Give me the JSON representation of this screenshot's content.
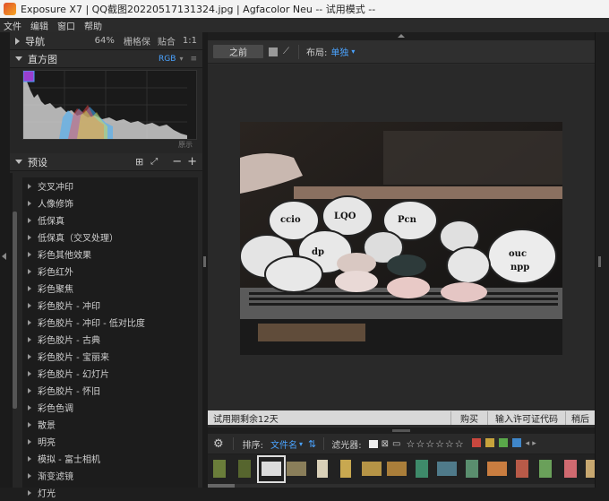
{
  "titlebar": {
    "title": "Exposure X7 | QQ截图20220517131324.jpg | Agfacolor Neu -- 试用模式 --"
  },
  "menu": [
    "文件",
    "编辑",
    "窗口",
    "帮助"
  ],
  "navigator": {
    "label": "导航",
    "zoom": "64%",
    "grid": "栅格保",
    "fit": "贴合",
    "one_to_one": "1:1"
  },
  "histogram": {
    "label": "直方图",
    "mode": "RGB",
    "clip_label": "原示"
  },
  "presets": {
    "label": "预设",
    "items": [
      "交叉冲印",
      "人像修饰",
      "低保真",
      "低保真（交叉处理）",
      "彩色其他效果",
      "彩色红外",
      "彩色聚焦",
      "彩色胶片 - 冲印",
      "彩色胶片 - 冲印 - 低对比度",
      "彩色胶片 - 古典",
      "彩色胶片 - 宝丽来",
      "彩色胶片 - 幻灯片",
      "彩色胶片 - 怀旧",
      "彩色色调",
      "散景",
      "明亮",
      "模拟 - 富士相机",
      "渐变滤镜",
      "灯光"
    ]
  },
  "toolbar": {
    "before_label": "之前",
    "layout_label": "布局:",
    "layout_value": "单独"
  },
  "trial": {
    "message": "试用期剩余12天",
    "buy": "购买",
    "license": "输入许可证代码",
    "later": "稍后"
  },
  "filmbar": {
    "sort_label": "排序:",
    "sort_value": "文件名",
    "filter_label": "滤光器:"
  },
  "colors": {
    "accent": "#4aa3ff",
    "swatches": [
      "#c9473e",
      "#c7a33c",
      "#5aa84a",
      "#3f86c9"
    ]
  }
}
